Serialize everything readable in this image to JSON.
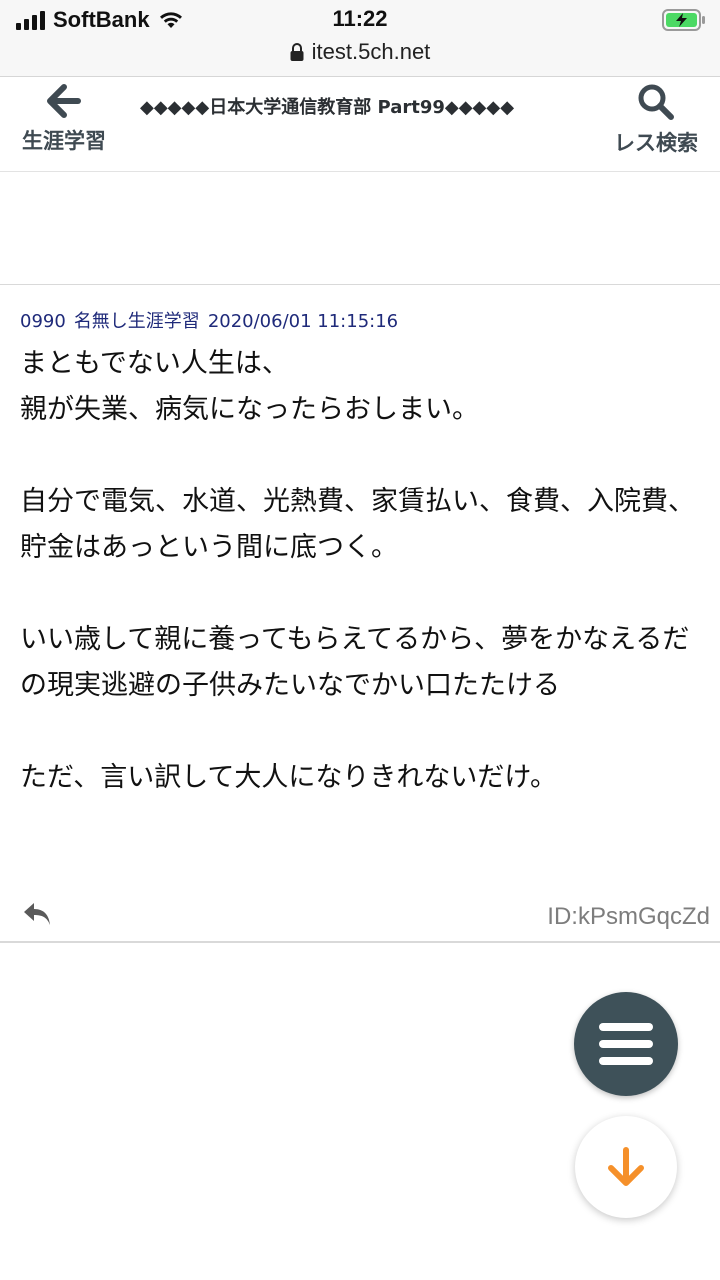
{
  "status_bar": {
    "carrier": "SoftBank",
    "time": "11:22"
  },
  "browser": {
    "url": "itest.5ch.net"
  },
  "header": {
    "back_label": "生涯学習",
    "thread_title": "◆◆◆◆◆日本大学通信教育部 Part99◆◆◆◆◆",
    "search_label": "レス検索"
  },
  "post": {
    "number": "0990",
    "name": "名無し生涯学習",
    "date": "2020/06/01 11:15:16",
    "body": {
      "line1": "まともでない人生は、",
      "line2": "親が失業、病気になったらおしまい。",
      "line3": "自分で電気、水道、光熱費、家賃払い、食費、入院費、",
      "line4": "貯金はあっという間に底つく。",
      "line5": "いい歳して親に養ってもらえてるから、夢をかなえるだの現実逃避の子供みたいなでかい口たたける",
      "line6": "ただ、言い訳して大人になりきれないだけ。"
    },
    "id": "ID:kPsmGqcZd"
  },
  "colors": {
    "meta_blue": "#1f2a7a",
    "fab_dark": "#3e5159",
    "arrow_orange": "#f5902a"
  },
  "icons": [
    "signal-icon",
    "wifi-icon",
    "battery-charging-icon",
    "lock-icon",
    "back-arrow-icon",
    "search-icon",
    "reply-icon",
    "menu-icon",
    "arrow-down-icon"
  ]
}
